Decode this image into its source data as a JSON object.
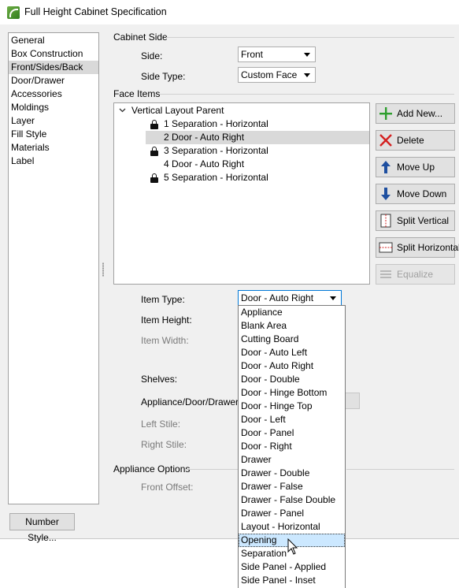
{
  "window": {
    "title": "Full Height Cabinet Specification"
  },
  "categories": {
    "items": [
      "General",
      "Box Construction",
      "Front/Sides/Back",
      "Door/Drawer",
      "Accessories",
      "Moldings",
      "Layer",
      "Fill Style",
      "Materials",
      "Label"
    ],
    "selected": "Front/Sides/Back"
  },
  "cabinet_side": {
    "heading": "Cabinet Side",
    "side_label": "Side:",
    "side_value": "Front",
    "side_type_label": "Side Type:",
    "side_type_value": "Custom Face"
  },
  "face_items": {
    "heading": "Face Items",
    "root": "Vertical Layout Parent",
    "rows": [
      {
        "text": "1 Separation - Horizontal",
        "locked": true
      },
      {
        "text": "2 Door - Auto Right",
        "locked": false
      },
      {
        "text": "3 Separation - Horizontal",
        "locked": true
      },
      {
        "text": "4 Door - Auto Right",
        "locked": false
      },
      {
        "text": "5 Separation - Horizontal",
        "locked": true
      }
    ],
    "selected_row": "2 Door - Auto Right"
  },
  "buttons": {
    "add_new": "Add New...",
    "delete": "Delete",
    "move_up": "Move Up",
    "move_down": "Move Down",
    "split_vertical": "Split Vertical",
    "split_horizontal": "Split Horizontal",
    "equalize": "Equalize"
  },
  "item_fields": {
    "item_type_label": "Item Type:",
    "item_type_value": "Door - Auto Right",
    "item_height_label": "Item Height:",
    "item_width_label": "Item Width:",
    "shelves_label": "Shelves:",
    "appliance_door_drawer_label": "Appliance/Door/Drawer:",
    "left_stile_label": "Left Stile:",
    "right_stile_label": "Right Stile:"
  },
  "appliance_options": {
    "heading": "Appliance Options",
    "front_offset_label": "Front Offset:"
  },
  "item_type_options": [
    "Appliance",
    "Blank Area",
    "Cutting Board",
    "Door - Auto Left",
    "Door - Auto Right",
    "Door - Double",
    "Door - Hinge Bottom",
    "Door - Hinge Top",
    "Door - Left",
    "Door - Panel",
    "Door - Right",
    "Drawer",
    "Drawer - Double",
    "Drawer - False",
    "Drawer - False Double",
    "Drawer - Panel",
    "Layout - Horizontal",
    "Opening",
    "Separation",
    "Side Panel - Applied",
    "Side Panel - Inset"
  ],
  "item_type_hovered": "Opening",
  "footer": {
    "number_style": "Number Style..."
  },
  "icons": {
    "app": "chief-architect-app-icon",
    "add": "green-plus-icon",
    "delete": "red-x-icon",
    "move_up": "blue-up-arrow-icon",
    "move_down": "blue-down-arrow-icon",
    "split_vertical": "split-vertical-icon",
    "split_horizontal": "split-horizontal-icon",
    "equalize": "equalize-icon",
    "lock": "lock-icon",
    "expand": "chevron-down-icon",
    "cursor": "mouse-pointer-icon"
  },
  "colors": {
    "dialog_bg": "#f0f0f0",
    "selection": "#d9d9d9",
    "hover": "#cce8ff",
    "add": "#2e9e2e",
    "delete": "#d42020",
    "arrow": "#1e4fa0"
  }
}
